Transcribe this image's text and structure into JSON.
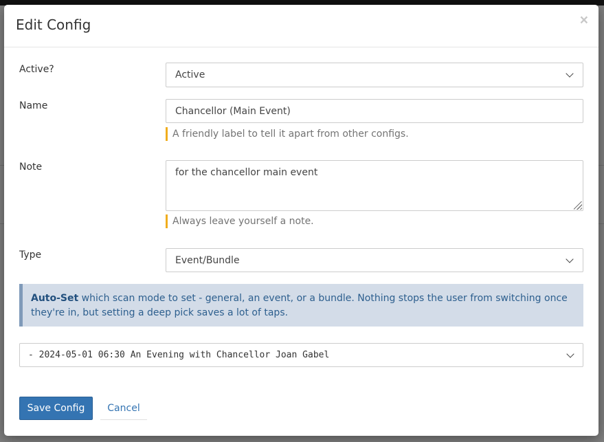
{
  "modal": {
    "title": "Edit Config",
    "close": "×"
  },
  "form": {
    "active": {
      "label": "Active?",
      "value": "Active"
    },
    "name": {
      "label": "Name",
      "value": "Chancellor (Main Event)",
      "help": "A friendly label to tell it apart from other configs."
    },
    "note": {
      "label": "Note",
      "value": "for the chancellor main event",
      "help": "Always leave yourself a note."
    },
    "type": {
      "label": "Type",
      "value": "Event/Bundle"
    },
    "callout": {
      "strong": "Auto-Set",
      "text": " which scan mode to set - general, an event, or a bundle. Nothing stops the user from switching once they're in, but setting a deep pick saves a lot of taps."
    },
    "event": {
      "value": "- 2024-05-01 06:30 An Evening with Chancellor Joan Gabel"
    }
  },
  "buttons": {
    "save": "Save Config",
    "cancel": "Cancel"
  },
  "colors": {
    "primary": "#3474b2",
    "help_border": "#f0ad1e",
    "callout_bg": "#d3dce8",
    "callout_border": "#7f9ab9"
  }
}
